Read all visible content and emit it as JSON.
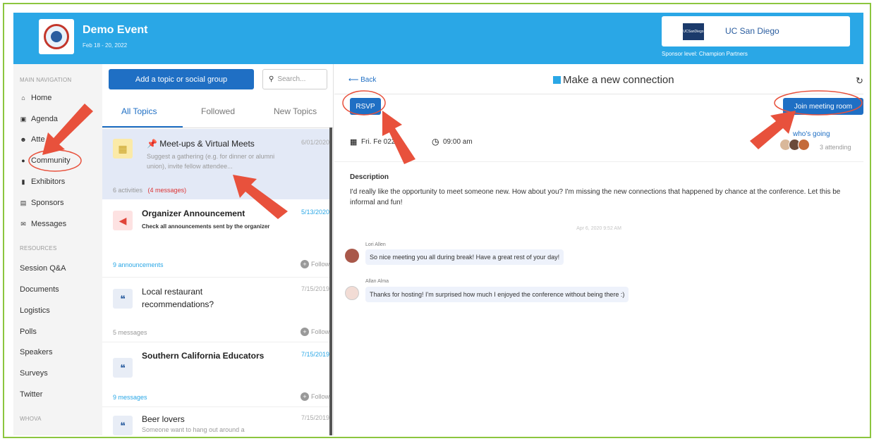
{
  "header": {
    "event_title": "Demo Event",
    "event_date": "Feb 18 - 20, 2022",
    "sponsor_logo_text": "UCSanDiego",
    "sponsor_name": "UC San Diego",
    "sponsor_level": "Sponsor level: Champion Partners"
  },
  "nav": {
    "main_label": "MAIN NAVIGATION",
    "main_items": [
      {
        "label": "Home",
        "icon": "home-icon"
      },
      {
        "label": "Agenda",
        "icon": "calendar-icon"
      },
      {
        "label": "Atte",
        "icon": "people-icon"
      },
      {
        "label": "Community",
        "icon": "chat-icon"
      },
      {
        "label": "Exhibitors",
        "icon": "building-icon"
      },
      {
        "label": "Sponsors",
        "icon": "document-icon"
      },
      {
        "label": "Messages",
        "icon": "envelope-icon"
      }
    ],
    "resources_label": "RESOURCES",
    "resource_items": [
      "Session Q&A",
      "Documents",
      "Logistics",
      "Polls",
      "Speakers",
      "Surveys",
      "Twitter"
    ],
    "whova_label": "WHOVA"
  },
  "topics": {
    "add_button": "Add a topic or social group",
    "search_placeholder": "Search...",
    "tabs": [
      "All Topics",
      "Followed",
      "New Topics"
    ],
    "items": [
      {
        "title": "Meet-ups & Virtual Meets",
        "sub": "Suggest a gathering (e.g. for dinner or alumni union), invite fellow attendee...",
        "date": "6/01/2020",
        "meta": "6 activities",
        "meta2": "(4 messages)"
      },
      {
        "title": "Organizer Announcement",
        "sub": "Check all announcements sent by the organizer",
        "date": "5/13/2020",
        "meta": "9 announcements",
        "follow": "Follow"
      },
      {
        "title": "Local restaurant recommendations?",
        "date": "7/15/2019",
        "meta": "5 messages",
        "follow": "Follow"
      },
      {
        "title": "Southern California Educators",
        "date": "7/15/2019",
        "meta": "9 messages",
        "follow": "Follow"
      },
      {
        "title": "Beer lovers",
        "sub": "Someone want to hang out around a",
        "date": "7/15/2019"
      }
    ]
  },
  "detail": {
    "back": "Back",
    "title": "Make a new connection",
    "rsvp": "RSVP",
    "join": "Join meeting room",
    "date": "Fri. Fe        022",
    "time": "09:00 am",
    "whos_going": "who's going",
    "attending": "3 attending",
    "desc_label": "Description",
    "desc_text": "I'd really like the opportunity to meet someone new. How about you? I'm missing the new connections that happened by chance at the conference. Let this be informal and fun!",
    "timestamp": "Apr 6, 2020 9:52 AM",
    "messages": [
      {
        "name": "Lori Allen",
        "text": "So nice meeting you all during break! Have a great rest of your day!"
      },
      {
        "name": "Allan Alma",
        "text": "Thanks for hosting! I'm surprised how much I enjoyed the conference without being there :)"
      }
    ]
  },
  "colors": {
    "header": "#2aa7e6",
    "primary": "#1f6fc4",
    "border": "#8cc63f",
    "annotation": "#e8513c"
  }
}
